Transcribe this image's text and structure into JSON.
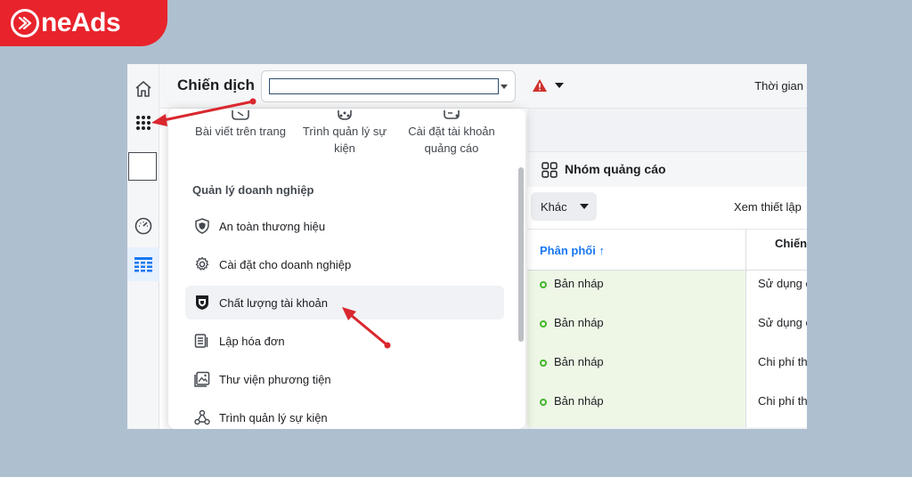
{
  "brand": {
    "logo_text": "neAds",
    "color": "#e8232b"
  },
  "header": {
    "title": "Chiến dịch",
    "campaign_select_value": "",
    "time_label": "Thời gian"
  },
  "rail": {
    "icons": [
      "home-icon",
      "all-tools-grid-icon",
      "account-square-icon",
      "dashboard-gauge-icon",
      "table-icon"
    ]
  },
  "menu": {
    "shortcuts": [
      {
        "label_line1": "Bài viết trên trang",
        "label_line2": "",
        "icon": "page-posts-icon"
      },
      {
        "label_line1": "Trình quản lý sự",
        "label_line2": "kiện",
        "icon": "events-manager-icon"
      },
      {
        "label_line1": "Cài đặt tài khoản",
        "label_line2": "quảng cáo",
        "icon": "ad-account-settings-icon"
      }
    ],
    "section_title": "Quản lý doanh nghiệp",
    "items": [
      {
        "label": "An toàn thương hiệu",
        "icon": "shield-icon"
      },
      {
        "label": "Cài đặt cho doanh nghiệp",
        "icon": "gear-icon"
      },
      {
        "label": "Chất lượng tài khoản",
        "icon": "account-quality-shield-icon"
      },
      {
        "label": "Lập hóa đơn",
        "icon": "billing-stack-icon"
      },
      {
        "label": "Thư viện phương tiện",
        "icon": "media-library-icon"
      },
      {
        "label": "Trình quản lý sự kiện",
        "icon": "events-nodes-icon"
      }
    ]
  },
  "adset_panel": {
    "title": "Nhóm quảng cáo",
    "other_button": "Khác",
    "view_settings": "Xem thiết lập",
    "columns": {
      "delivery": "Phân phối ↑",
      "campaign": "Chiến"
    },
    "rows": [
      {
        "status": "Bản nháp",
        "col2": "Sử dụng c"
      },
      {
        "status": "Bản nháp",
        "col2": "Sử dụng c"
      },
      {
        "status": "Bản nháp",
        "col2": "Chi phí th"
      },
      {
        "status": "Bản nháp",
        "col2": "Chi phí th"
      }
    ]
  },
  "colors": {
    "annotation_arrow": "#d9272e",
    "draft_dot": "#42b72a",
    "link_blue": "#1877f2"
  }
}
